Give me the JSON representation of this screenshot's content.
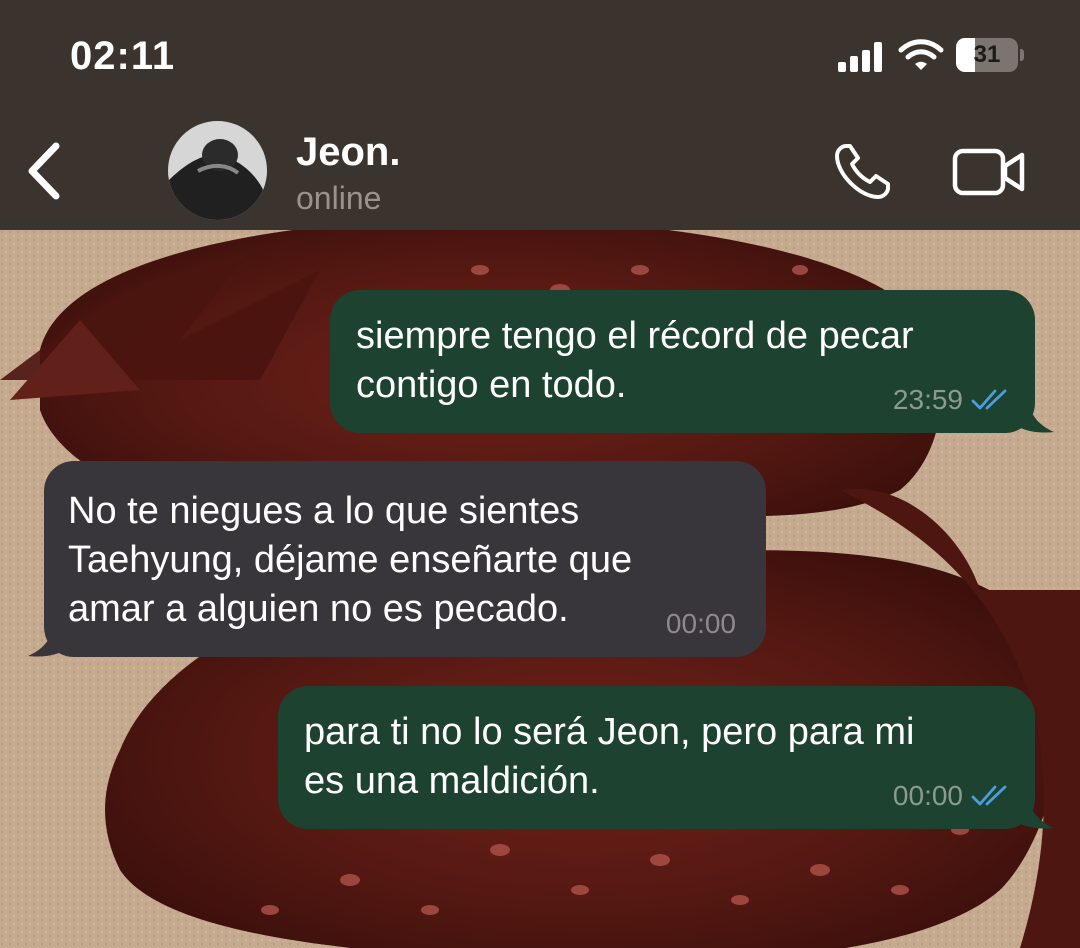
{
  "status_bar": {
    "time": "02:11",
    "battery_percent": "31",
    "battery_level": 0.31
  },
  "header": {
    "back_icon": "chevron-left-icon",
    "contact_name": "Jeon.",
    "contact_status": "online",
    "call_icon": "phone-icon",
    "video_icon": "video-camera-icon"
  },
  "messages": [
    {
      "direction": "outgoing",
      "lines": [
        "siempre tengo el récord de pecar",
        "contigo en todo."
      ],
      "time": "23:59",
      "status": "read"
    },
    {
      "direction": "incoming",
      "lines": [
        "No te niegues a lo que sientes",
        "Taehyung, déjame enseñarte que",
        "amar a alguien no es pecado."
      ],
      "time": "00:00"
    },
    {
      "direction": "outgoing",
      "lines": [
        "para ti no lo será Jeon, pero para mi",
        "es una maldición."
      ],
      "time": "00:00",
      "status": "read"
    }
  ],
  "colors": {
    "header_bg": "#3b332e",
    "outgoing_bubble": "#1e4230",
    "incoming_bubble": "#38363a",
    "read_ticks": "#4a9ee0",
    "wallpaper_bg": "#c9ae93",
    "wallpaper_fruit": "#5a1a14"
  }
}
